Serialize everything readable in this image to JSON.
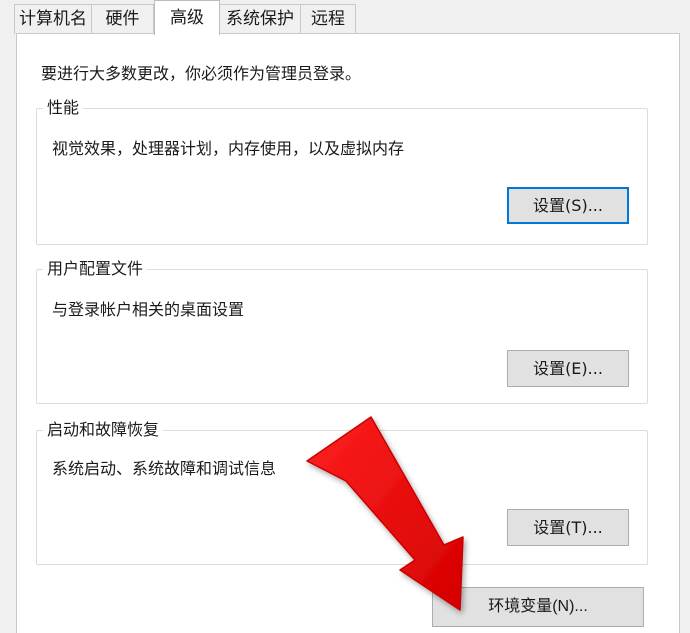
{
  "tabs": [
    {
      "label": "计算机名"
    },
    {
      "label": "硬件"
    },
    {
      "label": "高级"
    },
    {
      "label": "系统保护"
    },
    {
      "label": "远程"
    }
  ],
  "active_tab": "高级",
  "intro": "要进行大多数更改，你必须作为管理员登录。",
  "groups": {
    "performance": {
      "title": "性能",
      "description": "视觉效果，处理器计划，内存使用，以及虚拟内存",
      "button": "设置(S)..."
    },
    "user_profiles": {
      "title": "用户配置文件",
      "description": "与登录帐户相关的桌面设置",
      "button": "设置(E)..."
    },
    "startup_recovery": {
      "title": "启动和故障恢复",
      "description": "系统启动、系统故障和调试信息",
      "button": "设置(T)..."
    }
  },
  "env_button": "环境变量(N)...",
  "colors": {
    "arrow": "#ff0000",
    "focus_border": "#0078d7",
    "button_bg": "#e1e1e1"
  }
}
